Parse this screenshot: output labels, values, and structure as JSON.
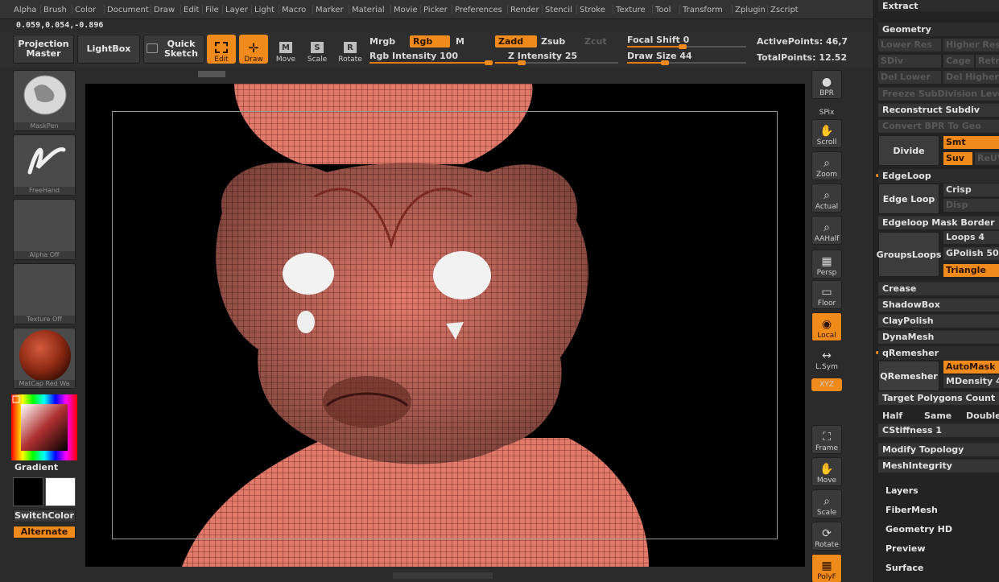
{
  "menu": [
    "Alpha",
    "Brush",
    "Color",
    "Document",
    "Draw",
    "Edit",
    "File",
    "Layer",
    "Light",
    "Macro",
    "Marker",
    "Material",
    "Movie",
    "Picker",
    "Preferences",
    "Render",
    "Stencil",
    "Stroke",
    "Texture",
    "Tool",
    "Transform",
    "Zplugin",
    "Zscript"
  ],
  "coords": "0.059,0.054,-0.896",
  "toolbar": {
    "projection_master": "Projection\nMaster",
    "lightbox": "LightBox",
    "quick_sketch": "Quick\nSketch",
    "edit": "Edit",
    "draw": "Draw",
    "move": "Move",
    "scale": "Scale",
    "rotate": "Rotate",
    "mrgb": "Mrgb",
    "rgb": "Rgb",
    "m": "M",
    "rgb_intensity": "Rgb Intensity 100",
    "zadd": "Zadd",
    "zsub": "Zsub",
    "zcut": "Zcut",
    "z_intensity": "Z Intensity 25",
    "focal_shift": "Focal Shift 0",
    "draw_size": "Draw Size 44",
    "active_points": "ActivePoints: 46,7",
    "total_points": "TotalPoints: 12.52"
  },
  "left_shelf": {
    "brush": "MaskPen",
    "stroke": "FreeHand",
    "alpha": "Alpha Off",
    "texture": "Texture Off",
    "material": "MatCap Red Wa",
    "gradient": "Gradient",
    "switch_color": "SwitchColor",
    "alternate": "Alternate"
  },
  "right_shelf": [
    {
      "id": "bpr",
      "label": "BPR",
      "icon": "render-sphere-icon"
    },
    {
      "id": "spix",
      "label": "SPix",
      "icon": "slider-icon"
    },
    {
      "id": "scroll",
      "label": "Scroll",
      "icon": "hand-icon"
    },
    {
      "id": "zoom",
      "label": "Zoom",
      "icon": "magnifier-icon"
    },
    {
      "id": "actual",
      "label": "Actual",
      "icon": "magnifier-icon"
    },
    {
      "id": "aahalf",
      "label": "AAHalf",
      "icon": "magnifier-icon"
    },
    {
      "id": "persp",
      "label": "Persp",
      "icon": "grid-icon"
    },
    {
      "id": "floor",
      "label": "Floor",
      "icon": "floor-icon"
    },
    {
      "id": "local",
      "label": "Local",
      "icon": "local-icon"
    },
    {
      "id": "lsym",
      "label": "L.Sym",
      "icon": "symmetry-icon"
    },
    {
      "id": "xyz",
      "label": "XYZ",
      "icon": "xyz-icon"
    },
    {
      "id": "frame",
      "label": "Frame",
      "icon": "frame-icon"
    },
    {
      "id": "move",
      "label": "Move",
      "icon": "hand-icon"
    },
    {
      "id": "scale",
      "label": "Scale",
      "icon": "scale-icon"
    },
    {
      "id": "rotate",
      "label": "Rotate",
      "icon": "rotate-icon"
    },
    {
      "id": "polyf",
      "label": "PolyF",
      "icon": "polyframe-icon"
    }
  ],
  "palette": {
    "extract": "Extract",
    "geometry": "Geometry",
    "lower_res": "Lower Res",
    "higher_res": "Higher Res",
    "sdiv": "SDiv",
    "cage": "Cage",
    "retr": "Retr",
    "del_lower": "Del Lower",
    "del_higher": "Del Higher",
    "freeze": "Freeze SubDivision Levels",
    "reconstruct": "Reconstruct Subdiv",
    "convert_bpr": "Convert BPR To Geo",
    "divide": "Divide",
    "smt": "Smt",
    "suv": "Suv",
    "reuv": "ReUV",
    "edgeloop_header": "EdgeLoop",
    "edge_loop": "Edge Loop",
    "crisp": "Crisp",
    "disp": "Disp",
    "edgeloop_mask": "Edgeloop Mask Border",
    "groups_loops": "GroupsLoops",
    "loops": "Loops 4",
    "gpolish": "GPolish 50",
    "triangle": "Triangle",
    "crease": "Crease",
    "shadowbox": "ShadowBox",
    "claypolish": "ClayPolish",
    "dynamesh": "DynaMesh",
    "qremesher_header": "qRemesher",
    "qremesher": "QRemesher",
    "automask": "AutoMask",
    "mdensity": "MDensity 4",
    "target_polygons": "Target Polygons Count 1",
    "half": "Half",
    "same": "Same",
    "double": "Double",
    "cstiffness": "CStiffness 1",
    "modify_topology": "Modify Topology",
    "mesh_integrity": "MeshIntegrity",
    "layers": "Layers",
    "fibermesh": "FiberMesh",
    "geometry_hd": "Geometry HD",
    "preview": "Preview",
    "surface": "Surface"
  },
  "colors": {
    "accent": "#f08a1b",
    "mesh": "#e0776a",
    "background": "#2b2b2b"
  },
  "sliders": {
    "rgb_intensity": 1.0,
    "z_intensity": 0.25,
    "focal_shift": 0.5,
    "draw_size": 0.35
  }
}
